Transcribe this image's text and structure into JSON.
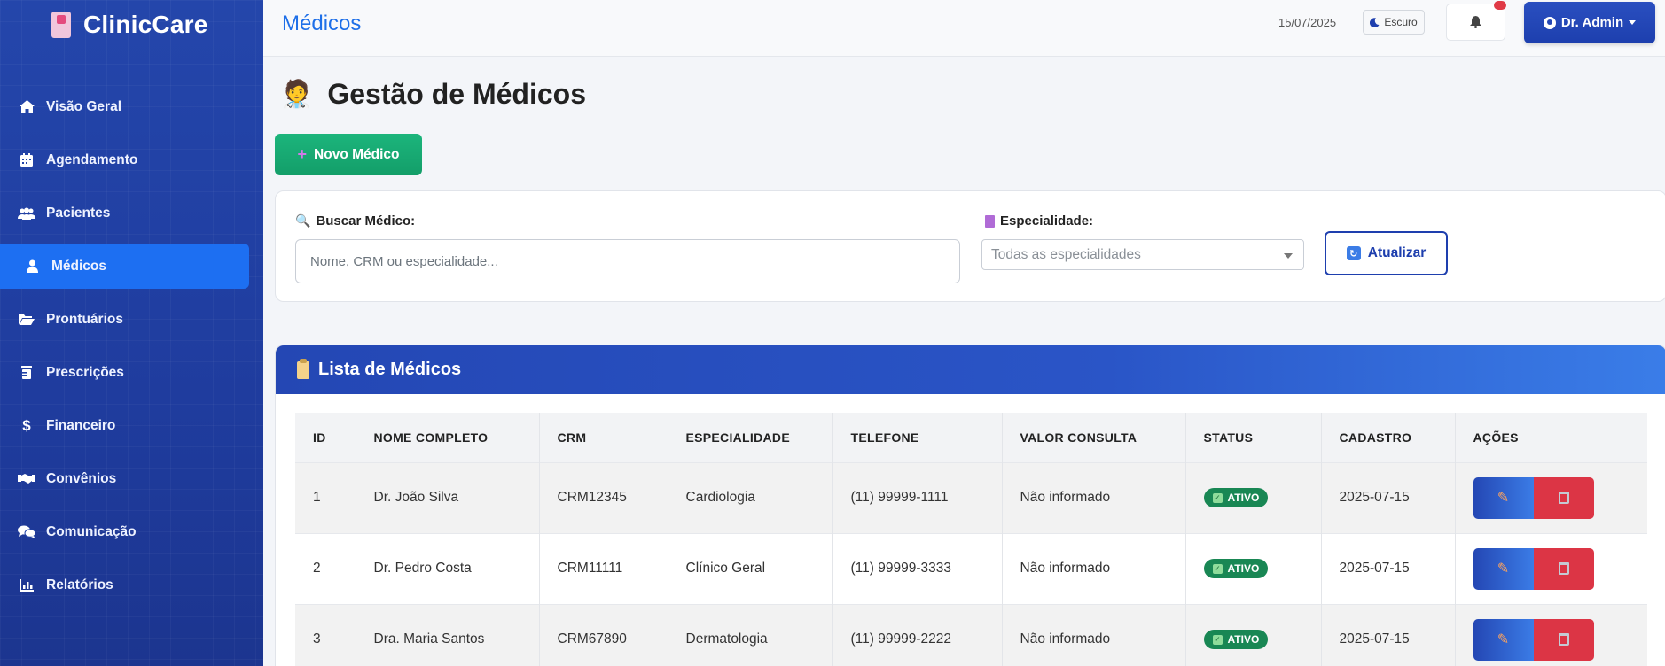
{
  "brand": {
    "name": "ClinicCare",
    "icon": "hospital-icon"
  },
  "sidebar": {
    "items": [
      {
        "label": "Visão Geral",
        "icon": "home-icon",
        "active": false
      },
      {
        "label": "Agendamento",
        "icon": "calendar-icon",
        "active": false
      },
      {
        "label": "Pacientes",
        "icon": "users-icon",
        "active": false
      },
      {
        "label": "Médicos",
        "icon": "user-md-icon",
        "active": true
      },
      {
        "label": "Prontuários",
        "icon": "folder-open-icon",
        "active": false
      },
      {
        "label": "Prescrições",
        "icon": "prescription-bottle-icon",
        "active": false
      },
      {
        "label": "Financeiro",
        "icon": "dollar-icon",
        "active": false
      },
      {
        "label": "Convênios",
        "icon": "handshake-icon",
        "active": false
      },
      {
        "label": "Comunicação",
        "icon": "comments-icon",
        "active": false
      },
      {
        "label": "Relatórios",
        "icon": "chart-bar-icon",
        "active": false
      }
    ]
  },
  "topbar": {
    "title": "Médicos",
    "date": "15/07/2025",
    "theme_label": "Escuro",
    "user_label": "Dr. Admin"
  },
  "main": {
    "heading": "Gestão de Médicos",
    "heading_icon": "doctor-emoji-icon",
    "new_button": "Novo Médico",
    "filters": {
      "search_label": "Buscar Médico:",
      "search_placeholder": "Nome, CRM ou especialidade...",
      "search_value": "",
      "specialty_label": "Especialidade:",
      "specialty_selected": "Todas as especialidades",
      "refresh_button": "Atualizar"
    },
    "list": {
      "title": "Lista de Médicos",
      "columns": [
        "ID",
        "NOME COMPLETO",
        "CRM",
        "ESPECIALIDADE",
        "TELEFONE",
        "VALOR CONSULTA",
        "STATUS",
        "CADASTRO",
        "AÇÕES"
      ],
      "rows": [
        {
          "id": "1",
          "name": "Dr. João Silva",
          "crm": "CRM12345",
          "specialty": "Cardiologia",
          "phone": "(11) 99999-1111",
          "fee": "Não informado",
          "status": "ATIVO",
          "created": "2025-07-15"
        },
        {
          "id": "2",
          "name": "Dr. Pedro Costa",
          "crm": "CRM11111",
          "specialty": "Clínico Geral",
          "phone": "(11) 99999-3333",
          "fee": "Não informado",
          "status": "ATIVO",
          "created": "2025-07-15"
        },
        {
          "id": "3",
          "name": "Dra. Maria Santos",
          "crm": "CRM67890",
          "specialty": "Dermatologia",
          "phone": "(11) 99999-2222",
          "fee": "Não informado",
          "status": "ATIVO",
          "created": "2025-07-15"
        }
      ]
    }
  },
  "colors": {
    "sidebar": "#2244a8",
    "accent": "#1e6fe8",
    "success": "#198754",
    "danger": "#dc3545",
    "new_button": "#17a873"
  }
}
